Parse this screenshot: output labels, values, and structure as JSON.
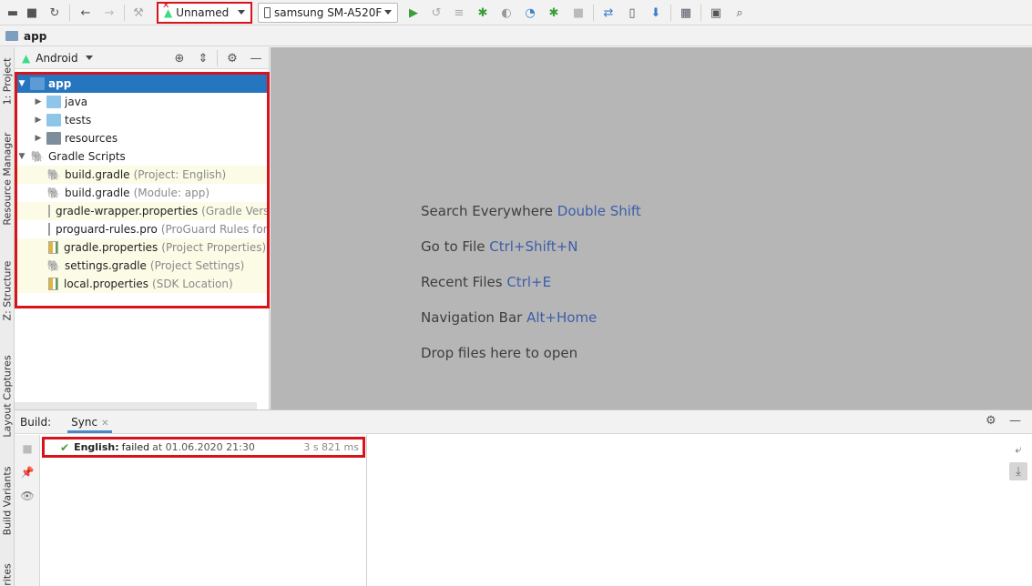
{
  "toolbar": {
    "icons": [
      "folder-icon",
      "save-icon",
      "sync-icon",
      "back-icon",
      "forward-icon",
      "build-icon",
      "run-icon",
      "apply-changes-icon",
      "apply-code-changes-icon",
      "debug-icon",
      "profile-icon",
      "attach-debugger-icon",
      "stop-icon",
      "sync-gradle-icon",
      "avd-manager-icon",
      "sdk-manager-icon",
      "project-structure-icon",
      "layout-inspector-icon",
      "search-icon"
    ],
    "run_config": "Unnamed",
    "device": "samsung SM-A520F"
  },
  "breadcrumb": {
    "root": "app"
  },
  "left_tabs": [
    "1: Project",
    "Resource Manager",
    "Z: Structure",
    "Layout Captures",
    "Build Variants",
    "rites"
  ],
  "project_panel": {
    "view": "Android",
    "tree": [
      {
        "label": "app",
        "hint": "",
        "icon": "module-icon",
        "twist": "▼"
      },
      {
        "label": "java",
        "hint": "",
        "icon": "folder-icon",
        "twist": "▶"
      },
      {
        "label": "tests",
        "hint": "",
        "icon": "folder-icon",
        "twist": "▶"
      },
      {
        "label": "resources",
        "hint": "",
        "icon": "resources-folder-icon",
        "twist": "▶"
      },
      {
        "label": "Gradle Scripts",
        "hint": "",
        "icon": "gradle-icon",
        "twist": "▼"
      },
      {
        "label": "build.gradle",
        "hint": "(Project: English)",
        "icon": "gradle-icon"
      },
      {
        "label": "build.gradle",
        "hint": "(Module: app)",
        "icon": "gradle-icon"
      },
      {
        "label": "gradle-wrapper.properties",
        "hint": "(Gradle Version)",
        "icon": "properties-icon"
      },
      {
        "label": "proguard-rules.pro",
        "hint": "(ProGuard Rules for ap",
        "icon": "file-icon"
      },
      {
        "label": "gradle.properties",
        "hint": "(Project Properties)",
        "icon": "properties-icon"
      },
      {
        "label": "settings.gradle",
        "hint": "(Project Settings)",
        "icon": "gradle-icon"
      },
      {
        "label": "local.properties",
        "hint": "(SDK Location)",
        "icon": "properties-icon"
      }
    ]
  },
  "editor": {
    "hints": [
      {
        "text": "Search Everywhere",
        "shortcut": "Double Shift"
      },
      {
        "text": "Go to File",
        "shortcut": "Ctrl+Shift+N"
      },
      {
        "text": "Recent Files",
        "shortcut": "Ctrl+E"
      },
      {
        "text": "Navigation Bar",
        "shortcut": "Alt+Home"
      },
      {
        "text": "Drop files here to open",
        "shortcut": ""
      }
    ]
  },
  "build": {
    "label": "Build:",
    "tab": "Sync",
    "result": {
      "project": "English:",
      "status": "failed",
      "time": "at 01.06.2020 21:30",
      "duration": "3 s 821 ms"
    }
  }
}
